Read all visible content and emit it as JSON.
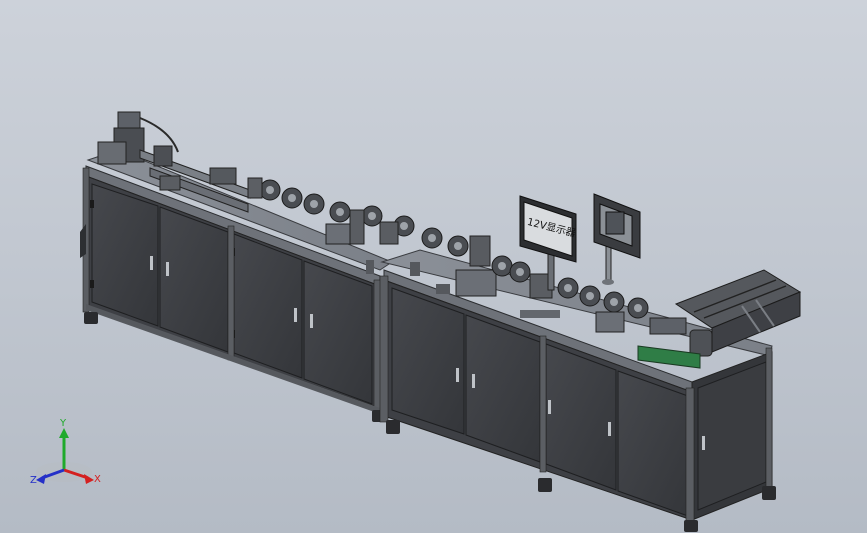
{
  "viewport": {
    "background_top": "#cdd2da",
    "background_bottom": "#b4bbc5"
  },
  "machine": {
    "display_panel_label": "12V显示器",
    "cabinet_color": "#3c3e42",
    "frame_color": "#5b5e63",
    "pcb_color": "#2f7d46"
  },
  "triad": {
    "x_label": "X",
    "y_label": "Y",
    "z_label": "Z",
    "x_color": "#d42020",
    "y_color": "#1faa2b",
    "z_color": "#2530c8"
  }
}
